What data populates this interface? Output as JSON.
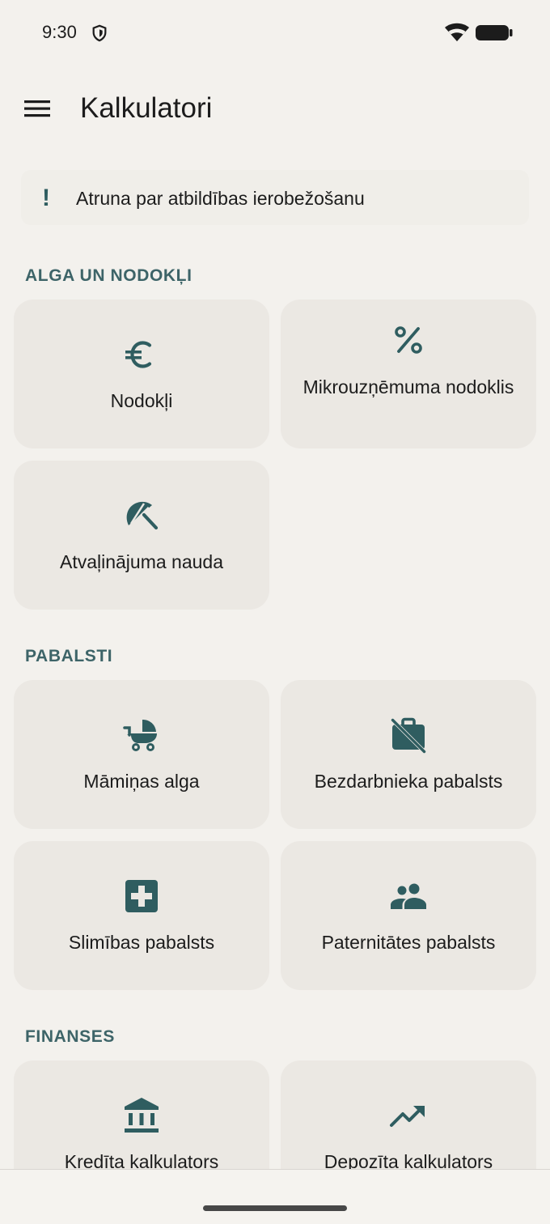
{
  "status_bar": {
    "time": "9:30"
  },
  "app_bar": {
    "title": "Kalkulatori"
  },
  "disclaimer": {
    "icon": "!",
    "label": "Atruna par atbildības ierobežošanu"
  },
  "sections": {
    "salary": {
      "title": "ALGA UN NODOKĻI",
      "cards": [
        {
          "label": "Nodokļi",
          "icon": "euro-icon"
        },
        {
          "label": "Mikrouzņēmuma nodoklis",
          "icon": "percent-icon"
        },
        {
          "label": "Atvaļinājuma nauda",
          "icon": "beach-umbrella-icon"
        }
      ]
    },
    "benefits": {
      "title": "PABALSTI",
      "cards": [
        {
          "label": "Māmiņas alga",
          "icon": "stroller-icon"
        },
        {
          "label": "Bezdarbnieka pabalsts",
          "icon": "work-off-icon"
        },
        {
          "label": "Slimības pabalsts",
          "icon": "medical-cross-icon"
        },
        {
          "label": "Paternitātes pabalsts",
          "icon": "people-icon"
        }
      ]
    },
    "finance": {
      "title": "FINANSES",
      "cards": [
        {
          "label": "Kredīta kalkulators",
          "icon": "bank-icon"
        },
        {
          "label": "Depozīta kalkulators",
          "icon": "trending-up-icon"
        }
      ]
    }
  },
  "colors": {
    "accent": "#2f5d60",
    "section_title": "#3d6468",
    "background": "#f3f1ed",
    "card": "#ebe8e3"
  }
}
